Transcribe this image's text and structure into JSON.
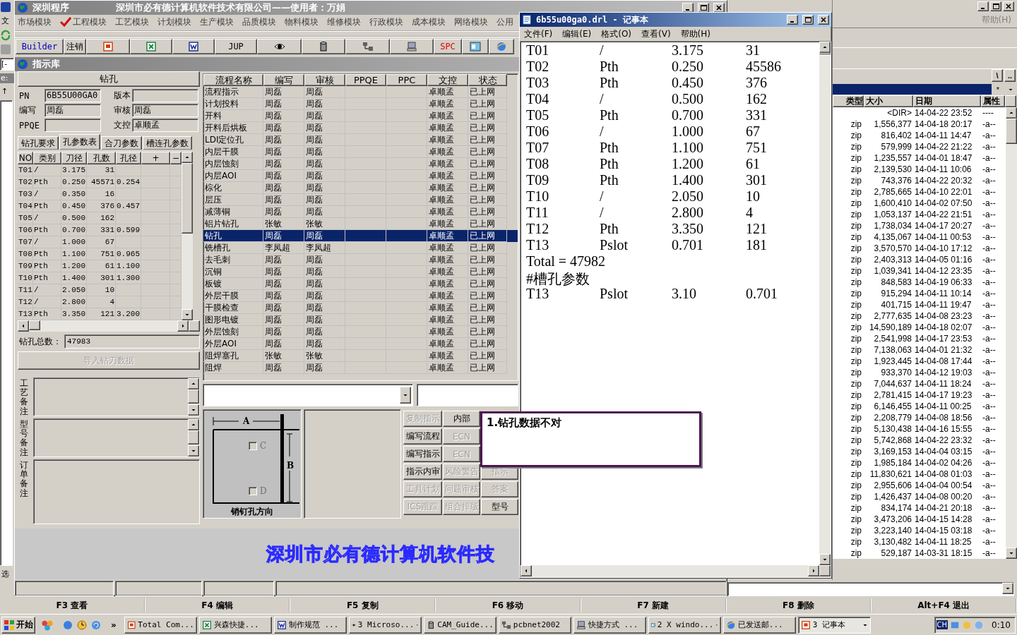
{
  "background_window": {
    "menu_fragment": "文",
    "drive_fragment": "[-",
    "path_fragment": "e:",
    "sort_fragment": "↑",
    "bottom_fragment": "选",
    "help_menu": "帮助(H)",
    "path_buttons": [
      "\\",
      ".."
    ],
    "filter": "*",
    "columns": [
      "类型",
      "大小",
      "日期",
      "属性"
    ],
    "files": [
      {
        "size": "<DIR>",
        "date": "14-04-22 23:52",
        "attr": "----"
      },
      {
        "type": "zip",
        "size": "1,556,377",
        "date": "14-04-18 20:17",
        "attr": "-a--"
      },
      {
        "type": "zip",
        "size": "816,402",
        "date": "14-04-11 14:47",
        "attr": "-a--"
      },
      {
        "type": "zip",
        "size": "579,999",
        "date": "14-04-22 21:22",
        "attr": "-a--"
      },
      {
        "type": "zip",
        "size": "1,235,557",
        "date": "14-04-01 18:47",
        "attr": "-a--"
      },
      {
        "type": "zip",
        "size": "2,139,530",
        "date": "14-04-11 10:06",
        "attr": "-a--"
      },
      {
        "type": "zip",
        "size": "743,376",
        "date": "14-04-22 20:32",
        "attr": "-a--"
      },
      {
        "type": "zip",
        "size": "2,785,665",
        "date": "14-04-10 22:01",
        "attr": "-a--"
      },
      {
        "type": "zip",
        "size": "1,600,410",
        "date": "14-04-02 07:50",
        "attr": "-a--"
      },
      {
        "type": "zip",
        "size": "1,053,137",
        "date": "14-04-22 21:51",
        "attr": "-a--"
      },
      {
        "type": "zip",
        "size": "1,738,034",
        "date": "14-04-17 20:27",
        "attr": "-a--"
      },
      {
        "type": "zip",
        "size": "4,135,067",
        "date": "14-04-11 00:53",
        "attr": "-a--"
      },
      {
        "type": "zip",
        "size": "3,570,570",
        "date": "14-04-10 17:12",
        "attr": "-a--"
      },
      {
        "type": "zip",
        "size": "2,403,313",
        "date": "14-04-05 01:16",
        "attr": "-a--"
      },
      {
        "type": "zip",
        "size": "1,039,341",
        "date": "14-04-12 23:35",
        "attr": "-a--"
      },
      {
        "type": "zip",
        "size": "848,583",
        "date": "14-04-19 06:33",
        "attr": "-a--"
      },
      {
        "type": "zip",
        "size": "915,294",
        "date": "14-04-11 10:14",
        "attr": "-a--"
      },
      {
        "type": "zip",
        "size": "401,715",
        "date": "14-04-11 19:47",
        "attr": "-a--"
      },
      {
        "type": "zip",
        "size": "2,777,635",
        "date": "14-04-08 23:23",
        "attr": "-a--"
      },
      {
        "type": "zip",
        "size": "14,590,189",
        "date": "14-04-18 02:07",
        "attr": "-a--"
      },
      {
        "type": "zip",
        "size": "2,541,998",
        "date": "14-04-17 23:53",
        "attr": "-a--"
      },
      {
        "type": "zip",
        "size": "7,138,063",
        "date": "14-04-01 21:32",
        "attr": "-a--"
      },
      {
        "type": "zip",
        "size": "1,923,445",
        "date": "14-04-08 17:44",
        "attr": "-a--"
      },
      {
        "type": "zip",
        "size": "933,370",
        "date": "14-04-12 19:03",
        "attr": "-a--"
      },
      {
        "type": "zip",
        "size": "7,044,637",
        "date": "14-04-11 18:24",
        "attr": "-a--"
      },
      {
        "type": "zip",
        "size": "2,781,415",
        "date": "14-04-17 19:23",
        "attr": "-a--"
      },
      {
        "type": "zip",
        "size": "6,146,455",
        "date": "14-04-11 00:25",
        "attr": "-a--"
      },
      {
        "type": "zip",
        "size": "2,208,779",
        "date": "14-04-08 18:56",
        "attr": "-a--"
      },
      {
        "type": "zip",
        "size": "5,130,438",
        "date": "14-04-16 15:55",
        "attr": "-a--"
      },
      {
        "type": "zip",
        "size": "5,742,868",
        "date": "14-04-22 23:32",
        "attr": "-a--"
      },
      {
        "type": "zip",
        "size": "3,169,153",
        "date": "14-04-04 03:15",
        "attr": "-a--"
      },
      {
        "type": "zip",
        "size": "1,985,184",
        "date": "14-04-02 04:26",
        "attr": "-a--"
      },
      {
        "type": "zip",
        "size": "11,830,621",
        "date": "14-04-08 01:03",
        "attr": "-a--"
      },
      {
        "type": "zip",
        "size": "2,955,606",
        "date": "14-04-04 00:54",
        "attr": "-a--"
      },
      {
        "type": "zip",
        "size": "1,426,437",
        "date": "14-04-08 00:20",
        "attr": "-a--"
      },
      {
        "type": "zip",
        "size": "834,174",
        "date": "14-04-21 20:18",
        "attr": "-a--"
      },
      {
        "type": "zip",
        "size": "3,473,206",
        "date": "14-04-15 14:28",
        "attr": "-a--"
      },
      {
        "type": "zip",
        "size": "3,223,140",
        "date": "14-04-15 03:18",
        "attr": "-a--"
      },
      {
        "type": "zip",
        "size": "3,130,482",
        "date": "14-04-11 18:25",
        "attr": "-a--"
      },
      {
        "type": "zip",
        "size": "529,187",
        "date": "14-03-31 18:15",
        "attr": "-a--"
      }
    ]
  },
  "app": {
    "title": "深圳程序",
    "caption": "深圳市必有德计算机软件技术有限公司——使用者：万娟",
    "modules": [
      {
        "label": "市场模块",
        "checked": false
      },
      {
        "label": "工程模块",
        "checked": true
      },
      {
        "label": "工艺模块",
        "checked": false
      },
      {
        "label": "计划模块",
        "checked": false
      },
      {
        "label": "生产模块",
        "checked": false
      },
      {
        "label": "品质模块",
        "checked": false
      },
      {
        "label": "物料模块",
        "checked": false
      },
      {
        "label": "维修模块",
        "checked": false
      },
      {
        "label": "行政模块",
        "checked": false
      },
      {
        "label": "成本模块",
        "checked": false
      },
      {
        "label": "网络模块",
        "checked": false
      },
      {
        "label": "公用",
        "checked": false
      }
    ],
    "toolbar": [
      {
        "kind": "text",
        "label": "Builder",
        "color": "#0000c0"
      },
      {
        "kind": "text",
        "label": "注销",
        "color": "#000000"
      },
      {
        "kind": "icon"
      },
      {
        "kind": "icon"
      },
      {
        "kind": "icon"
      },
      {
        "kind": "text",
        "label": "JUP",
        "color": "#000000"
      },
      {
        "kind": "icon"
      },
      {
        "kind": "icon"
      },
      {
        "kind": "icon"
      },
      {
        "kind": "icon"
      },
      {
        "kind": "text",
        "label": "SPC",
        "color": "#e00000"
      },
      {
        "kind": "icon"
      },
      {
        "kind": "icon"
      }
    ],
    "child_window": {
      "title": "指示库",
      "drill_panel": {
        "header": "钻孔",
        "fields": [
          {
            "label": "PN",
            "value": "6B55U00GA0"
          },
          {
            "label": "版本"
          },
          {
            "label": "编写",
            "value": "周磊"
          },
          {
            "label": "审核",
            "value": "周磊"
          },
          {
            "label": "PPQE"
          },
          {
            "label": "文控",
            "value": "卓顺孟"
          }
        ],
        "tabs": [
          {
            "label": "钻孔要求",
            "selected": false
          },
          {
            "label": "孔参数表",
            "selected": true
          },
          {
            "label": "合刀参数",
            "selected": false
          },
          {
            "label": "槽连孔参数",
            "selected": false
          }
        ],
        "tool_table": {
          "columns": [
            "NO",
            "类别",
            "刀径",
            "孔数",
            "孔径",
            "+",
            "−"
          ],
          "rows": [
            [
              "T01",
              "/",
              "3.175",
              "31"
            ],
            [
              "T02",
              "Pth",
              "0.250",
              "45571",
              "0.254"
            ],
            [
              "T03",
              "/",
              "0.350",
              "16"
            ],
            [
              "T04",
              "Pth",
              "0.450",
              "376",
              "0.457"
            ],
            [
              "T05",
              "/",
              "0.500",
              "162"
            ],
            [
              "T06",
              "Pth",
              "0.700",
              "331",
              "0.599"
            ],
            [
              "T07",
              "/",
              "1.000",
              "67"
            ],
            [
              "T08",
              "Pth",
              "1.100",
              "751",
              "0.965"
            ],
            [
              "T09",
              "Pth",
              "1.200",
              "61",
              "1.100"
            ],
            [
              "T10",
              "Pth",
              "1.400",
              "301",
              "1.300"
            ],
            [
              "T11",
              "/",
              "2.050",
              "10"
            ],
            [
              "T12",
              "/",
              "2.800",
              "4"
            ],
            [
              "T13",
              "Pth",
              "3.350",
              "121",
              "3.200"
            ]
          ]
        },
        "total_label": "钻孔总数：",
        "total_value": "47983",
        "import_button": {
          "label": "导入钻刀数据",
          "disabled": true
        },
        "notes": [
          "工艺备注",
          "型号备注",
          "订单备注"
        ]
      },
      "process_table": {
        "columns": [
          "流程名称",
          "编写",
          "审核",
          "PPQE",
          "PPC",
          "文控",
          "状态"
        ],
        "rows": [
          {
            "name": "流程指示",
            "author": "周磊",
            "reviewer": "周磊",
            "doc_control": "卓顺孟",
            "status": "已上网",
            "selected": false
          },
          {
            "name": "计划投料",
            "author": "周磊",
            "reviewer": "周磊",
            "doc_control": "卓顺孟",
            "status": "已上网",
            "selected": false
          },
          {
            "name": "开料",
            "author": "周磊",
            "reviewer": "周磊",
            "doc_control": "卓顺孟",
            "status": "已上网",
            "selected": false
          },
          {
            "name": "开料后烘板",
            "author": "周磊",
            "reviewer": "周磊",
            "doc_control": "卓顺孟",
            "status": "已上网",
            "selected": false
          },
          {
            "name": "LDI定位孔",
            "author": "周磊",
            "reviewer": "周磊",
            "doc_control": "卓顺孟",
            "status": "已上网",
            "selected": false
          },
          {
            "name": "内层干膜",
            "author": "周磊",
            "reviewer": "周磊",
            "doc_control": "卓顺孟",
            "status": "已上网",
            "selected": false
          },
          {
            "name": "内层蚀刻",
            "author": "周磊",
            "reviewer": "周磊",
            "doc_control": "卓顺孟",
            "status": "已上网",
            "selected": false
          },
          {
            "name": "内层AOI",
            "author": "周磊",
            "reviewer": "周磊",
            "doc_control": "卓顺孟",
            "status": "已上网",
            "selected": false
          },
          {
            "name": "棕化",
            "author": "周磊",
            "reviewer": "周磊",
            "doc_control": "卓顺孟",
            "status": "已上网",
            "selected": false
          },
          {
            "name": "层压",
            "author": "周磊",
            "reviewer": "周磊",
            "doc_control": "卓顺孟",
            "status": "已上网",
            "selected": false
          },
          {
            "name": "减薄铜",
            "author": "周磊",
            "reviewer": "周磊",
            "doc_control": "卓顺孟",
            "status": "已上网",
            "selected": false
          },
          {
            "name": "铝片钻孔",
            "author": "张敏",
            "reviewer": "张敏",
            "doc_control": "卓顺孟",
            "status": "已上网",
            "selected": false
          },
          {
            "name": "钻孔",
            "author": "周磊",
            "reviewer": "周磊",
            "doc_control": "卓顺孟",
            "status": "已上网",
            "selected": true
          },
          {
            "name": "铣槽孔",
            "author": "李凤超",
            "reviewer": "李凤超",
            "doc_control": "卓顺孟",
            "status": "已上网",
            "selected": false
          },
          {
            "name": "去毛刺",
            "author": "周磊",
            "reviewer": "周磊",
            "doc_control": "卓顺孟",
            "status": "已上网",
            "selected": false
          },
          {
            "name": "沉铜",
            "author": "周磊",
            "reviewer": "周磊",
            "doc_control": "卓顺孟",
            "status": "已上网",
            "selected": false
          },
          {
            "name": "板镀",
            "author": "周磊",
            "reviewer": "周磊",
            "doc_control": "卓顺孟",
            "status": "已上网",
            "selected": false
          },
          {
            "name": "外层干膜",
            "author": "周磊",
            "reviewer": "周磊",
            "doc_control": "卓顺孟",
            "status": "已上网",
            "selected": false
          },
          {
            "name": "干膜检查",
            "author": "周磊",
            "reviewer": "周磊",
            "doc_control": "卓顺孟",
            "status": "已上网",
            "selected": false
          },
          {
            "name": "图形电镀",
            "author": "周磊",
            "reviewer": "周磊",
            "doc_control": "卓顺孟",
            "status": "已上网",
            "selected": false
          },
          {
            "name": "外层蚀刻",
            "author": "周磊",
            "reviewer": "周磊",
            "doc_control": "卓顺孟",
            "status": "已上网",
            "selected": false
          },
          {
            "name": "外层AOI",
            "author": "周磊",
            "reviewer": "周磊",
            "doc_control": "卓顺孟",
            "status": "已上网",
            "selected": false
          },
          {
            "name": "阻焊塞孔",
            "author": "张敏",
            "reviewer": "张敏",
            "doc_control": "卓顺孟",
            "status": "已上网",
            "selected": false
          },
          {
            "name": "阻焊",
            "author": "周磊",
            "reviewer": "周磊",
            "doc_control": "卓顺孟",
            "status": "已上网",
            "selected": false
          }
        ]
      },
      "pin_diagram": {
        "a_label": "A",
        "b_label": "B",
        "c_label": "C",
        "c_checked": false,
        "d_label": "D",
        "d_checked": false,
        "caption": "销钉孔方向"
      },
      "action_buttons": [
        [
          {
            "label": "复制指示",
            "disabled": true
          },
          {
            "label": "内部",
            "disabled": false
          }
        ],
        [
          {
            "label": "编写流程",
            "disabled": false
          },
          {
            "label": "ECN",
            "disabled": true
          }
        ],
        [
          {
            "label": "编写指示",
            "disabled": false
          },
          {
            "label": "ECN",
            "disabled": true
          }
        ],
        [
          {
            "label": "指示内审",
            "disabled": false
          },
          {
            "label": "风险警告",
            "disabled": true
          },
          {
            "label": "指示",
            "disabled": true
          }
        ],
        [
          {
            "label": "工具计划",
            "disabled": true
          },
          {
            "label": "问题审核",
            "disabled": true
          },
          {
            "label": "答案",
            "disabled": true
          }
        ],
        [
          {
            "label": "ICS跟踪",
            "disabled": true
          },
          {
            "label": "组合排版",
            "disabled": true
          },
          {
            "label": "型号",
            "disabled": false
          }
        ]
      ],
      "banner": "深圳市必有德计算机软件技"
    }
  },
  "message": "1.钻孔数据不对",
  "notepad": {
    "title": "6b55u00ga0.drl - 记事本",
    "menu": [
      "文件(F)",
      "编辑(E)",
      "格式(O)",
      "查看(V)",
      "帮助(H)"
    ],
    "lines": [
      [
        "T01",
        "/",
        "3.175",
        "31"
      ],
      [
        "T02",
        "Pth",
        "0.250",
        "45586"
      ],
      [
        "T03",
        "Pth",
        "0.450",
        "376"
      ],
      [
        "T04",
        "/",
        "0.500",
        "162"
      ],
      [
        "T05",
        "Pth",
        "0.700",
        "331"
      ],
      [
        "T06",
        "/",
        "1.000",
        "67"
      ],
      [
        "T07",
        "Pth",
        "1.100",
        "751"
      ],
      [
        "T08",
        "Pth",
        "1.200",
        "61"
      ],
      [
        "T09",
        "Pth",
        "1.400",
        "301"
      ],
      [
        "T10",
        "/",
        "2.050",
        "10"
      ],
      [
        "T11",
        "/",
        "2.800",
        "4"
      ],
      [
        "T12",
        "Pth",
        "3.350",
        "121"
      ],
      [
        "T13",
        "Pslot",
        "0.701",
        "181"
      ],
      [
        "Total = 47982"
      ],
      [
        "#槽孔参数"
      ],
      [
        "T13",
        "Pslot",
        "3.10",
        "0.701"
      ]
    ]
  },
  "function_keys": [
    "F3 查看",
    "F4 编辑",
    "F5 复制",
    "F6 移动",
    "F7 新建",
    "F8 删除",
    "Alt+F4 退出"
  ],
  "taskbar": {
    "start": "开始",
    "quick_more": "»",
    "tasks": [
      {
        "label": "Total Com...",
        "selected": false,
        "grouped": false
      },
      {
        "label": "兴森快捷...",
        "selected": false,
        "grouped": false
      },
      {
        "label": "制作规范 ...",
        "selected": false,
        "grouped": false
      },
      {
        "label": "3 Microso...",
        "selected": false,
        "grouped": true
      },
      {
        "label": "CAM_Guide...",
        "selected": false,
        "grouped": false
      },
      {
        "label": "pcbnet2002",
        "selected": false,
        "grouped": false
      },
      {
        "label": "快捷方式 ...",
        "selected": false,
        "grouped": false
      },
      {
        "label": "2 X windo...",
        "selected": false,
        "grouped": true
      },
      {
        "label": "已发送邮...",
        "selected": false,
        "grouped": false
      },
      {
        "label": "3 记事本",
        "selected": true,
        "grouped": true
      }
    ],
    "input_lang": "CH",
    "clock": "0:10"
  }
}
